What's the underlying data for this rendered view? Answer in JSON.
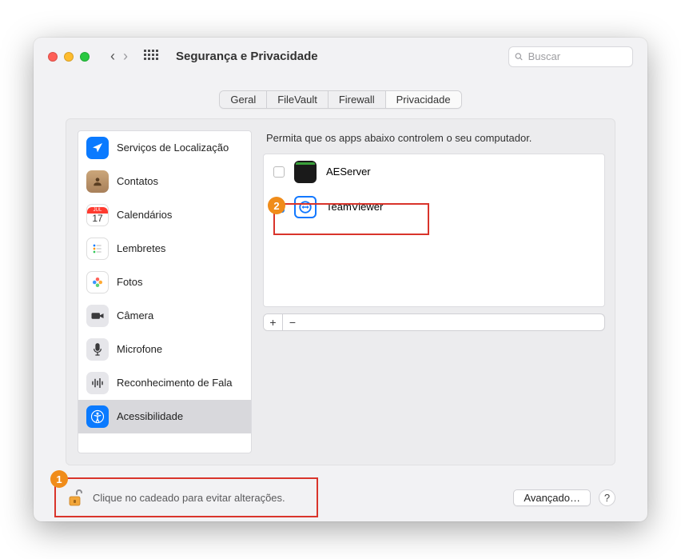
{
  "window": {
    "title": "Segurança e Privacidade"
  },
  "search": {
    "placeholder": "Buscar"
  },
  "tabs": [
    {
      "label": "Geral",
      "selected": false
    },
    {
      "label": "FileVault",
      "selected": false
    },
    {
      "label": "Firewall",
      "selected": false
    },
    {
      "label": "Privacidade",
      "selected": true
    }
  ],
  "sidebar": [
    {
      "label": "Serviços de Localização",
      "icon": "location",
      "color": "#0a7aff"
    },
    {
      "label": "Contatos",
      "icon": "contacts",
      "color": "#b58a5c"
    },
    {
      "label": "Calendários",
      "icon": "calendar",
      "color": "#ffffff"
    },
    {
      "label": "Lembretes",
      "icon": "reminders",
      "color": "#ffffff"
    },
    {
      "label": "Fotos",
      "icon": "photos",
      "color": "#ffffff"
    },
    {
      "label": "Câmera",
      "icon": "camera",
      "color": "#e6e6ea"
    },
    {
      "label": "Microfone",
      "icon": "mic",
      "color": "#e6e6ea"
    },
    {
      "label": "Reconhecimento de Fala",
      "icon": "speech",
      "color": "#e6e6ea"
    },
    {
      "label": "Acessibilidade",
      "icon": "accessibility",
      "color": "#0a7aff",
      "selected": true
    }
  ],
  "content": {
    "instruction": "Permita que os apps abaixo controlem o seu computador.",
    "apps": [
      {
        "name": "AEServer",
        "checked": false,
        "icon": "terminal"
      },
      {
        "name": "TeamViewer",
        "checked": true,
        "icon": "teamviewer"
      }
    ]
  },
  "footer": {
    "lock_text": "Clique no cadeado para evitar alterações.",
    "advanced": "Avançado…"
  },
  "callouts": {
    "badge1": "1",
    "badge2": "2"
  }
}
